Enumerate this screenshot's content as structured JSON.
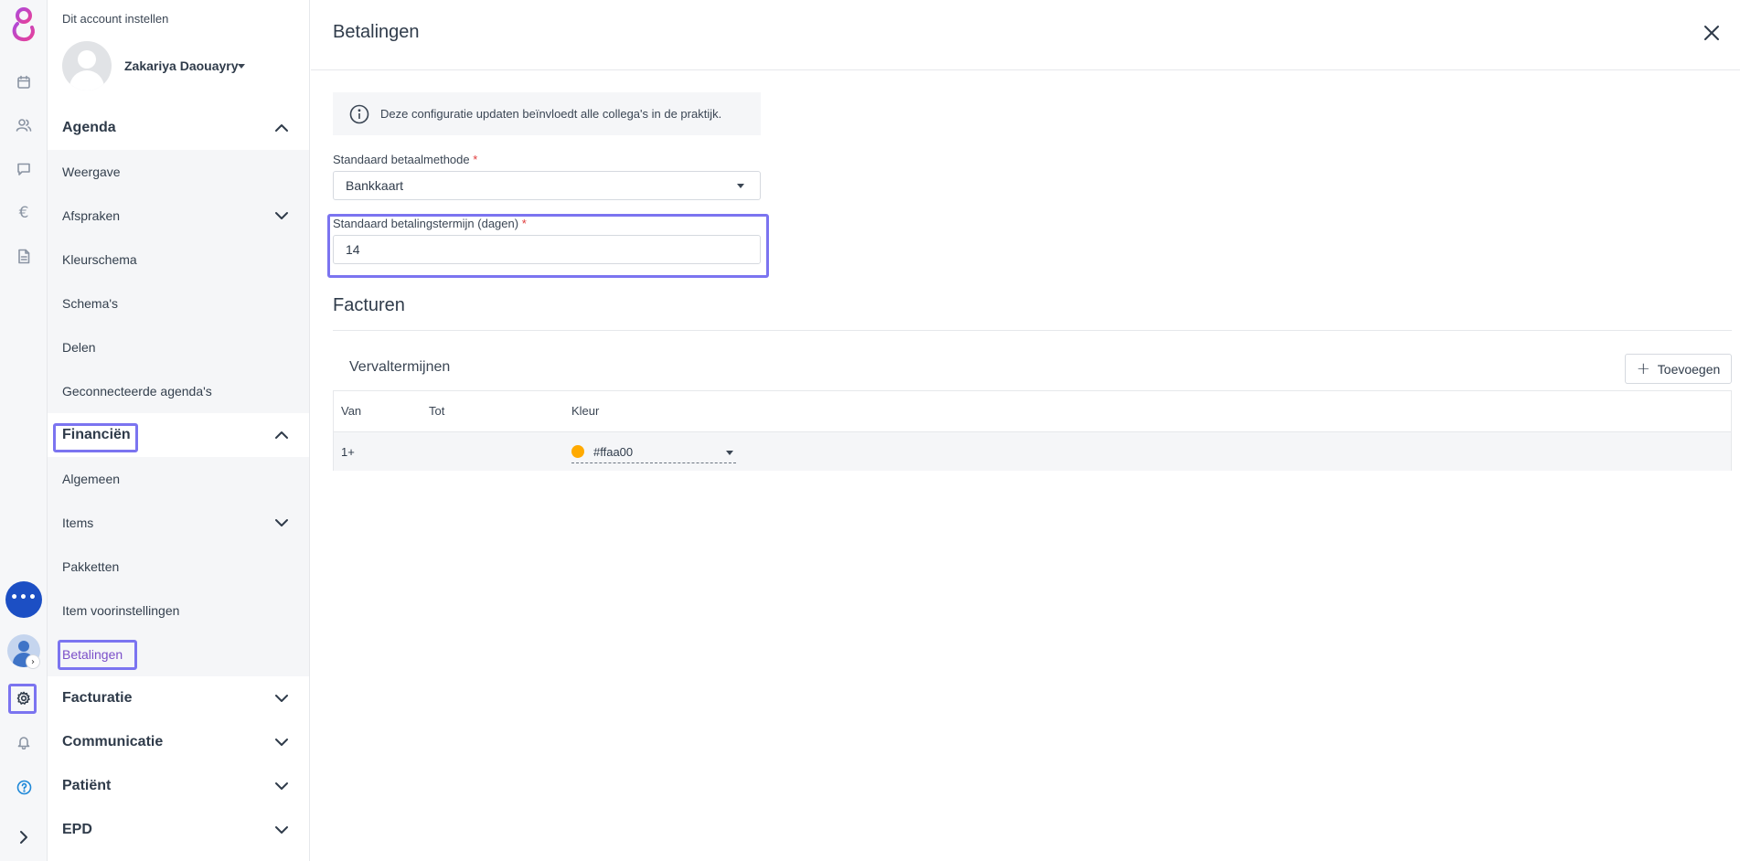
{
  "rail": {
    "items": [
      "app-logo",
      "calendar-icon",
      "users-icon",
      "chat-icon",
      "euro-icon",
      "document-icon",
      "chat-bubble-icon",
      "avatar",
      "gear-icon",
      "bell-icon",
      "help-icon",
      "chevron-right-icon"
    ],
    "euro_glyph": "€",
    "chat_dots": "•••",
    "avatar_badge": "›"
  },
  "sidebar": {
    "account_title": "Dit account instellen",
    "user_name": "Zakariya Daouayry",
    "sections": [
      {
        "label": "Agenda",
        "expanded": true,
        "items": [
          {
            "label": "Weergave"
          },
          {
            "label": "Afspraken",
            "has_children": true
          },
          {
            "label": "Kleurschema"
          },
          {
            "label": "Schema's"
          },
          {
            "label": "Delen"
          },
          {
            "label": "Geconnecteerde agenda's"
          }
        ]
      },
      {
        "label": "Financiën",
        "expanded": true,
        "items": [
          {
            "label": "Algemeen"
          },
          {
            "label": "Items",
            "has_children": true
          },
          {
            "label": "Pakketten"
          },
          {
            "label": "Item voorinstellingen"
          },
          {
            "label": "Betalingen",
            "active": true
          }
        ]
      },
      {
        "label": "Facturatie",
        "expanded": false
      },
      {
        "label": "Communicatie",
        "expanded": false
      },
      {
        "label": "Patiënt",
        "expanded": false
      },
      {
        "label": "EPD",
        "expanded": false
      }
    ]
  },
  "main": {
    "title": "Betalingen",
    "info_text": "Deze configuratie updaten beïnvloedt alle collega's in de praktijk.",
    "payment_method": {
      "label": "Standaard betaalmethode",
      "required_mark": "*",
      "value": "Bankkaart"
    },
    "payment_term": {
      "label": "Standaard betalingstermijn (dagen)",
      "required_mark": "*",
      "value": "14"
    },
    "invoices_title": "Facturen",
    "terms_title": "Vervaltermijnen",
    "add_button": "Toevoegen",
    "add_plus": "+",
    "table": {
      "headers": {
        "from": "Van",
        "to": "Tot",
        "color": "Kleur"
      },
      "rows": [
        {
          "from": "1+",
          "to": "",
          "color": "#ffaa00"
        }
      ]
    }
  },
  "colors": {
    "accent": "#7b74f0",
    "active_link": "#7b4fc9",
    "chat_fab": "#1c4fc4",
    "row_color_dot": "#ffaa00"
  }
}
